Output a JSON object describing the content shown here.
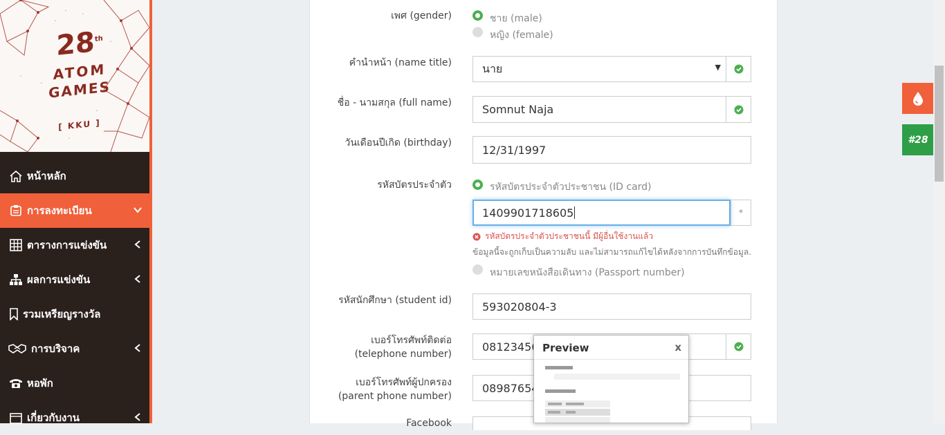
{
  "logo": {
    "number": "28",
    "suffix": "th",
    "line1": "ATOM",
    "line2": "GAMES",
    "sub": "[ KKU ]"
  },
  "nav": [
    {
      "label": "หน้าหลัก",
      "icon": "home-icon"
    },
    {
      "label": "การลงทะเบียน",
      "icon": "id-card-icon"
    },
    {
      "label": "ตารางการแข่งขัน",
      "icon": "table-icon"
    },
    {
      "label": "ผลการแข่งขัน",
      "icon": "sitemap-icon"
    },
    {
      "label": "รวมเหรียญรางวัล",
      "icon": "bookmark-icon"
    },
    {
      "label": "การบริจาค",
      "icon": "handshake-icon"
    },
    {
      "label": "หอพัก",
      "icon": "phone-icon"
    },
    {
      "label": "เกี่ยวกับงาน",
      "icon": "calendar-icon"
    }
  ],
  "form": {
    "gender_label": "เพศ (gender)",
    "gender_male": "ชาย (male)",
    "gender_female": "หญิง (female)",
    "title_label": "คำนำหน้า (name title)",
    "title_value": "นาย",
    "fullname_label": "ชื่อ - นามสกุล (full name)",
    "fullname_value": "Somnut Naja",
    "birthday_label": "วันเดือนปีเกิด (birthday)",
    "birthday_value": "12/31/1997",
    "idcard_label": "รหัสบัตรประจำตัว",
    "idcard_option": "รหัสบัตรประจำตัวประชาชน (ID card)",
    "idcard_value": "1409901718605",
    "idcard_required": "*",
    "idcard_error": "รหัสบัตรประจำตัวประชาชนนี้ มีผู้อื่นใช้งานแล้ว",
    "idcard_note": "ข้อมูลนี้จะถูกเก็บเป็นความลับ และไม่สามารถแก้ไขได้หลังจากการบันทึกข้อมูล.",
    "passport_option": "หมายเลขหนังสือเดินทาง (Passport number)",
    "student_label": "รหัสนักศึกษา (student id)",
    "student_value": "593020804-3",
    "phone_label1": "เบอร์โทรศัพท์ติดต่อ",
    "phone_label2": "(telephone number)",
    "phone_value": "081234567",
    "parent_label1": "เบอร์โทรศัพท์ผู้ปกครอง",
    "parent_label2": "(parent phone number)",
    "parent_value": "089876543",
    "facebook_label": "Facebook"
  },
  "preview": {
    "title": "Preview",
    "close": "x"
  },
  "float": {
    "hashtag": "#28"
  },
  "colors": {
    "accent": "#f0603a",
    "success": "#4caf50",
    "error": "#d9534f",
    "sidebar": "#2a201c"
  }
}
